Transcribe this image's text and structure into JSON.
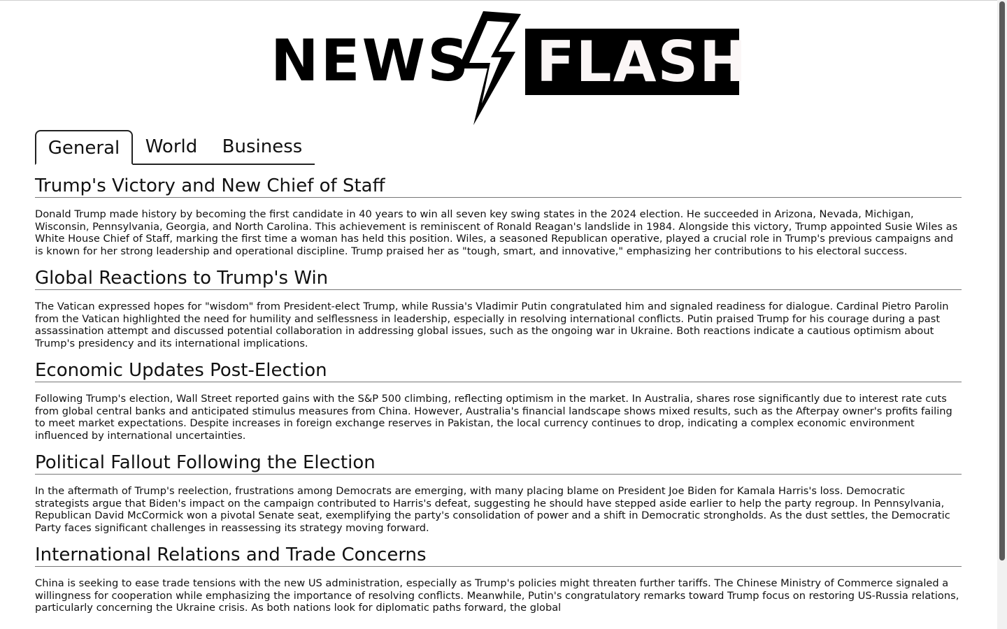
{
  "logo": {
    "word1": "NEWS",
    "word2": "FLASH",
    "icon": "lightning-bolt-icon"
  },
  "tabs": [
    {
      "label": "General",
      "active": true
    },
    {
      "label": "World",
      "active": false
    },
    {
      "label": "Business",
      "active": false
    }
  ],
  "articles": [
    {
      "title": "Trump's Victory and New Chief of Staff",
      "body": "Donald Trump made history by becoming the first candidate in 40 years to win all seven key swing states in the 2024 election. He succeeded in Arizona, Nevada, Michigan, Wisconsin, Pennsylvania, Georgia, and North Carolina. This achievement is reminiscent of Ronald Reagan's landslide in 1984. Alongside this victory, Trump appointed Susie Wiles as White House Chief of Staff, marking the first time a woman has held this position. Wiles, a seasoned Republican operative, played a crucial role in Trump's previous campaigns and is known for her strong leadership and operational discipline. Trump praised her as \"tough, smart, and innovative,\" emphasizing her contributions to his electoral success."
    },
    {
      "title": "Global Reactions to Trump's Win",
      "body": "The Vatican expressed hopes for \"wisdom\" from President-elect Trump, while Russia's Vladimir Putin congratulated him and signaled readiness for dialogue. Cardinal Pietro Parolin from the Vatican highlighted the need for humility and selflessness in leadership, especially in resolving international conflicts. Putin praised Trump for his courage during a past assassination attempt and discussed potential collaboration in addressing global issues, such as the ongoing war in Ukraine. Both reactions indicate a cautious optimism about Trump's presidency and its international implications."
    },
    {
      "title": "Economic Updates Post-Election",
      "body": "Following Trump's election, Wall Street reported gains with the S&P 500 climbing, reflecting optimism in the market. In Australia, shares rose significantly due to interest rate cuts from global central banks and anticipated stimulus measures from China. However, Australia's financial landscape shows mixed results, such as the Afterpay owner's profits failing to meet market expectations. Despite increases in foreign exchange reserves in Pakistan, the local currency continues to drop, indicating a complex economic environment influenced by international uncertainties."
    },
    {
      "title": "Political Fallout Following the Election",
      "body": "In the aftermath of Trump's reelection, frustrations among Democrats are emerging, with many placing blame on President Joe Biden for Kamala Harris's loss. Democratic strategists argue that Biden's impact on the campaign contributed to Harris's defeat, suggesting he should have stepped aside earlier to help the party regroup. In Pennsylvania, Republican David McCormick won a pivotal Senate seat, exemplifying the party's consolidation of power and a shift in Democratic strongholds. As the dust settles, the Democratic Party faces significant challenges in reassessing its strategy moving forward."
    },
    {
      "title": "International Relations and Trade Concerns",
      "body": "China is seeking to ease trade tensions with the new US administration, especially as Trump's policies might threaten further tariffs. The Chinese Ministry of Commerce signaled a willingness for cooperation while emphasizing the importance of resolving conflicts. Meanwhile, Putin's congratulatory remarks toward Trump focus on restoring US-Russia relations, particularly concerning the Ukraine crisis. As both nations look for diplomatic paths forward, the global"
    }
  ]
}
